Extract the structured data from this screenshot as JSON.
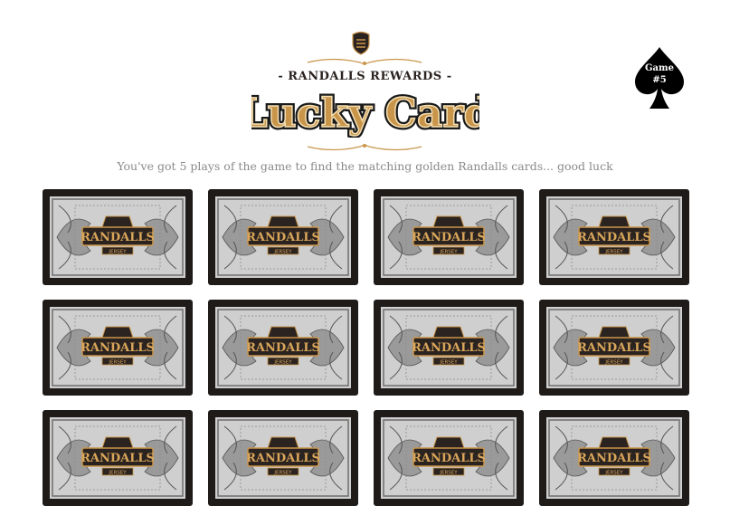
{
  "header": {
    "rewards": "- RANDALLS REWARDS -",
    "logo_text": "Lucky Card",
    "tagline": "You've got 5 plays of the game to find the matching golden Randalls cards... good luck"
  },
  "badge": {
    "line1": "Game",
    "line2": "#5"
  },
  "cards": [
    {
      "label": "RANDALLS",
      "sub": "JERSEY"
    },
    {
      "label": "RANDALLS",
      "sub": "JERSEY"
    },
    {
      "label": "RANDALLS",
      "sub": "JERSEY"
    },
    {
      "label": "RANDALLS",
      "sub": "JERSEY"
    },
    {
      "label": "RANDALLS",
      "sub": "JERSEY"
    },
    {
      "label": "RANDALLS",
      "sub": "JERSEY"
    },
    {
      "label": "RANDALLS",
      "sub": "JERSEY"
    },
    {
      "label": "RANDALLS",
      "sub": "JERSEY"
    },
    {
      "label": "RANDALLS",
      "sub": "JERSEY"
    },
    {
      "label": "RANDALLS",
      "sub": "JERSEY"
    },
    {
      "label": "RANDALLS",
      "sub": "JERSEY"
    },
    {
      "label": "RANDALLS",
      "sub": "JERSEY"
    }
  ],
  "colors": {
    "gold": "#c9954a",
    "card_border": "#1f1b19",
    "tagline": "#8a8a8a",
    "spade": "#000000"
  }
}
